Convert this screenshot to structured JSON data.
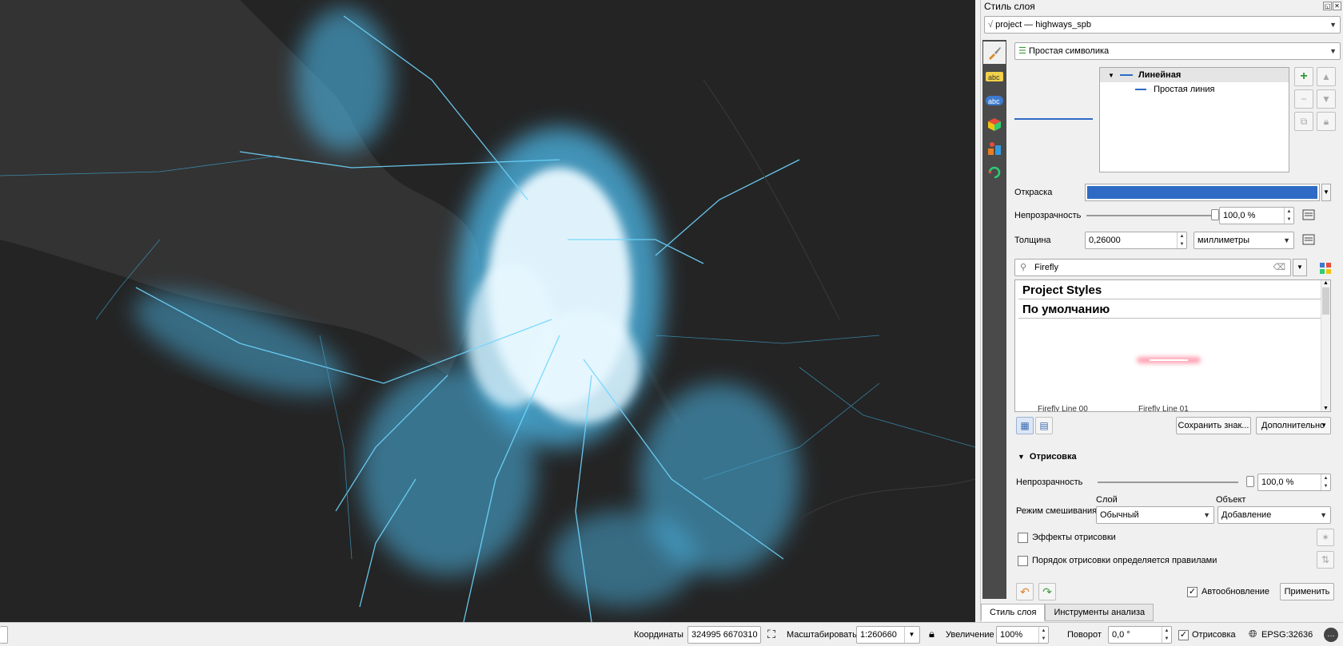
{
  "panel": {
    "title": "Стиль слоя",
    "layer_combo": "project — highways_spb",
    "renderer_combo": "Простая символика",
    "tree": {
      "root": "Линейная",
      "child": "Простая линия"
    },
    "color_label": "Откраска",
    "color_value": "#2f6bc4",
    "opacity_label": "Непрозрачность",
    "opacity_value": "100,0 %",
    "width_label": "Толщина",
    "width_value": "0,26000",
    "unit_value": "миллиметры",
    "search_value": "Firefly",
    "sym_headers": [
      "Project Styles",
      "По умолчанию"
    ],
    "sym_partial": [
      "Firefly Line 00",
      "Firefly Line 01"
    ],
    "save_btn": "Сохранить знак...",
    "advanced_btn": "Дополнительно",
    "render_section": "Отрисовка",
    "render_opacity_label": "Непрозрачность",
    "render_opacity_value": "100,0 %",
    "layer_label": "Слой",
    "object_label": "Объект",
    "blend_label": "Режим смешивания",
    "blend_layer": "Обычный",
    "blend_object": "Добавление",
    "effects_label": "Эффекты отрисовки",
    "order_label": "Порядок отрисовки определяется правилами",
    "autoupdate_label": "Автообновление",
    "apply_btn": "Применить",
    "tabs": [
      "Стиль слоя",
      "Инструменты анализа"
    ]
  },
  "status": {
    "coords_label": "Координаты",
    "coords_value": "324995 6670310",
    "scale_label": "Масштабировать",
    "scale_value": "1:260660",
    "zoom_label": "Увеличение",
    "zoom_value": "100%",
    "rotation_label": "Поворот",
    "rotation_value": "0,0 °",
    "render_label": "Отрисовка",
    "epsg": "EPSG:32636"
  },
  "colors": {
    "map_bg": "#262626",
    "water": "#3a3a3a",
    "roads": "#6fd6ff",
    "core": "#e8f8ff",
    "accent": "#2f6bc4"
  }
}
